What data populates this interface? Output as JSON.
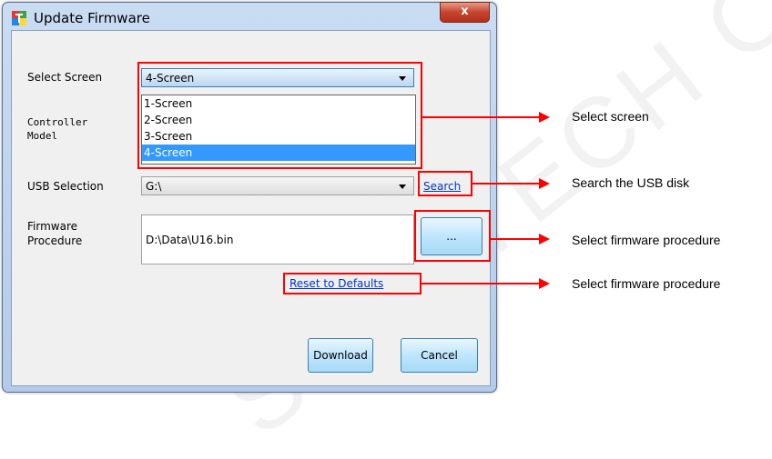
{
  "window": {
    "title": "Update Firmware",
    "close_label": "x"
  },
  "form": {
    "select_screen_label": "Select Screen",
    "select_screen_value": "4-Screen",
    "screen_options": [
      "1-Screen",
      "2-Screen",
      "3-Screen",
      "4-Screen"
    ],
    "controller_model_label_line1": "Controller",
    "controller_model_label_line2": "Model",
    "usb_selection_label": "USB Selection",
    "usb_selection_value": "G:\\",
    "search_link": "Search",
    "firmware_label_line1": "Firmware",
    "firmware_label_line2": "Procedure",
    "firmware_path": "D:\\Data\\U16.bin",
    "browse_label": "...",
    "reset_link": "Reset to Defaults",
    "download_label": "Download",
    "cancel_label": "Cancel"
  },
  "annotations": {
    "callout_1": "Select screen",
    "callout_2": "Search the USB disk",
    "callout_3": "Select firmware procedure",
    "callout_4": "Select firmware procedure"
  },
  "colors": {
    "annotation": "#ff0000",
    "link": "#0033cc",
    "selection": "#3399ff"
  },
  "watermark": "STARTECH CO."
}
